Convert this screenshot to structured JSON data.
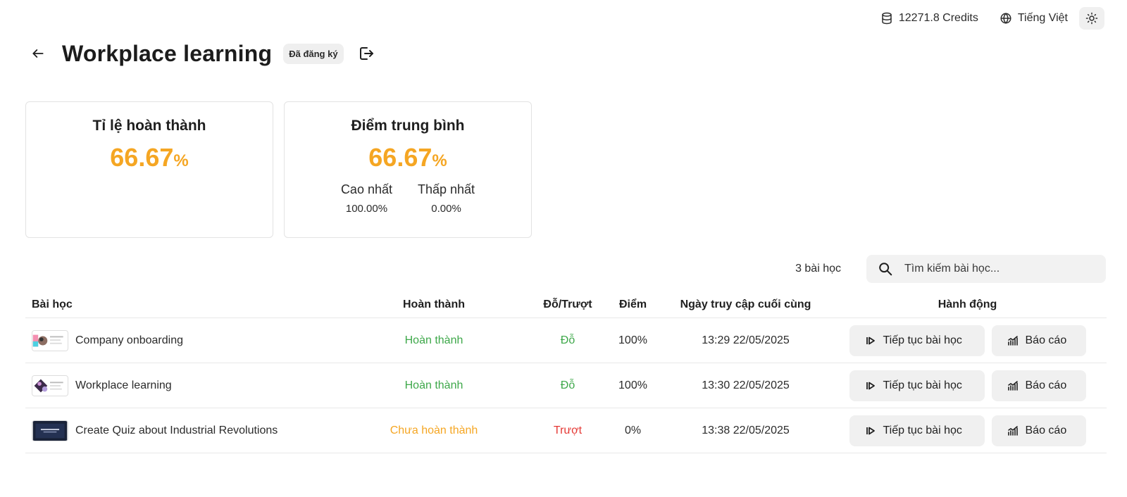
{
  "topbar": {
    "credits": "12271.8 Credits",
    "language": "Tiếng Việt"
  },
  "header": {
    "title": "Workplace learning",
    "badge": "Đã đăng ký"
  },
  "stats": {
    "completion": {
      "title": "Tỉ lệ hoàn thành",
      "value": "66.67",
      "unit": "%"
    },
    "average": {
      "title": "Điểm trung bình",
      "value": "66.67",
      "unit": "%",
      "highest_label": "Cao nhất",
      "highest_value": "100.00%",
      "lowest_label": "Thấp nhất",
      "lowest_value": "0.00%"
    }
  },
  "list": {
    "count": "3 bài học",
    "search_placeholder": "Tìm kiếm bài học..."
  },
  "table": {
    "headers": {
      "lesson": "Bài học",
      "done": "Hoàn thành",
      "pass": "Đỗ/Trượt",
      "score": "Điểm",
      "date": "Ngày truy cập cuối cùng",
      "actions": "Hành động"
    },
    "rows": [
      {
        "name": "Company onboarding",
        "done": "Hoàn thành",
        "pass": "Đỗ",
        "score": "100%",
        "date": "13:29 22/05/2025"
      },
      {
        "name": "Workplace learning",
        "done": "Hoàn thành",
        "pass": "Đỗ",
        "score": "100%",
        "date": "13:30 22/05/2025"
      },
      {
        "name": "Create Quiz about Industrial Revolutions",
        "done": "Chưa hoàn thành",
        "pass": "Trượt",
        "score": "0%",
        "date": "13:38 22/05/2025"
      }
    ],
    "continue_label": "Tiếp tục bài học",
    "report_label": "Báo cáo"
  },
  "colors": {
    "accent": "#f5a623",
    "success": "#3ea84a",
    "danger": "#e53935"
  }
}
